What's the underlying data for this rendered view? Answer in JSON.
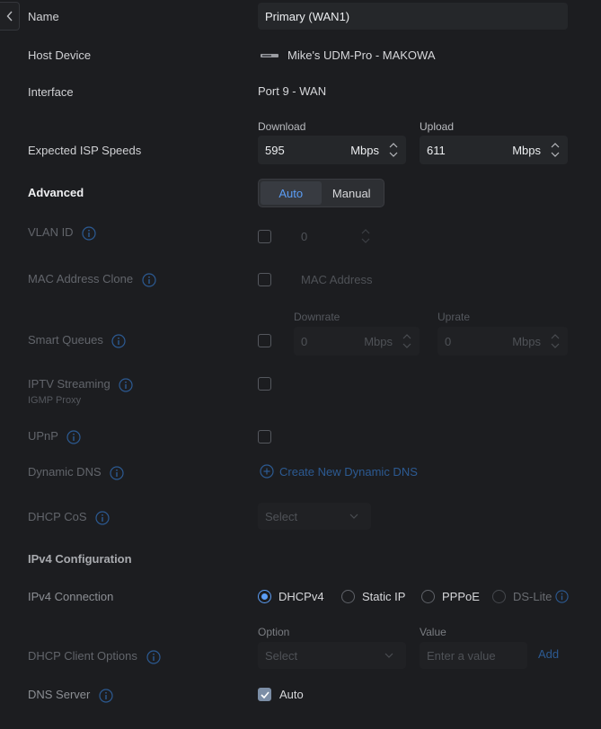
{
  "form": {
    "name_label": "Name",
    "name_value": "Primary (WAN1)",
    "host_label": "Host Device",
    "host_value": "Mike's UDM-Pro - MAKOWA",
    "interface_label": "Interface",
    "interface_value": "Port 9 - WAN",
    "isp_label": "Expected ISP Speeds",
    "download_label": "Download",
    "download_value": "595",
    "upload_label": "Upload",
    "upload_value": "611",
    "unit": "Mbps",
    "advanced_label": "Advanced",
    "advanced_options": [
      "Auto",
      "Manual"
    ],
    "advanced_selected": "Auto"
  },
  "advanced": {
    "vlan_label": "VLAN ID",
    "vlan_value": "0",
    "mac_label": "MAC Address Clone",
    "mac_placeholder": "MAC Address",
    "sq_label": "Smart Queues",
    "downrate_label": "Downrate",
    "uprate_label": "Uprate",
    "downrate_value": "0",
    "uprate_value": "0",
    "iptv_label": "IPTV Streaming",
    "iptv_sub": "IGMP Proxy",
    "upnp_label": "UPnP",
    "ddns_label": "Dynamic DNS",
    "ddns_link": "Create New Dynamic DNS",
    "cos_label": "DHCP CoS",
    "cos_placeholder": "Select"
  },
  "ipv4": {
    "section_label": "IPv4 Configuration",
    "connection_label": "IPv4 Connection",
    "options": [
      "DHCPv4",
      "Static IP",
      "PPPoE",
      "DS-Lite"
    ],
    "selected": "DHCPv4",
    "dhcp_opts_label": "DHCP Client Options",
    "option_col": "Option",
    "value_col": "Value",
    "option_placeholder": "Select",
    "value_placeholder": "Enter a value",
    "add_label": "Add",
    "dns_label": "DNS Server",
    "dns_auto": "Auto",
    "dns_auto_checked": true
  },
  "colors": {
    "background": "#1c1d20",
    "accent": "#5b9df5",
    "link": "#2c5a92"
  }
}
